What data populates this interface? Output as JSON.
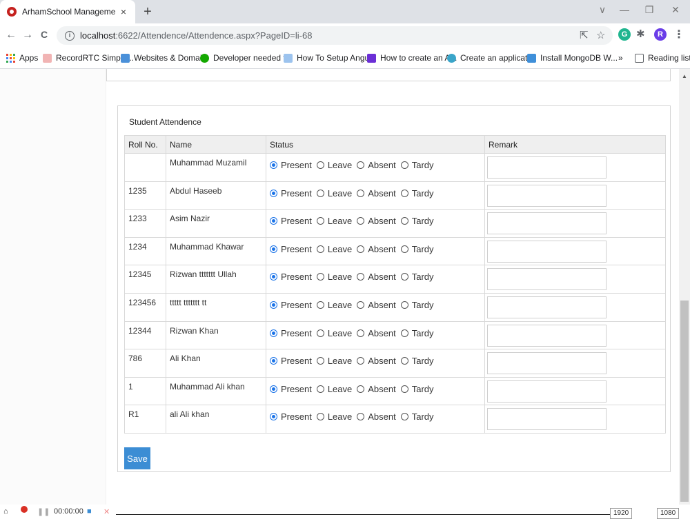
{
  "browser": {
    "tab_title": "ArhamSchool Management",
    "tab_close": "×",
    "new_tab": "+",
    "url_host": "localhost",
    "url_rest": ":6622/Attendence/Attendence.aspx?PageID=li-68",
    "window_controls": [
      "∨",
      "—",
      "❐",
      "✕"
    ],
    "nav": {
      "back": "←",
      "forward": "→",
      "reload": "C"
    },
    "extensions": [
      {
        "label": "G",
        "color": "#1fb58f"
      },
      {
        "label": "R",
        "color": "#6a3de8"
      }
    ],
    "bookmarks": [
      {
        "label": "Apps",
        "icon": "apps-grid-icon",
        "color": "#ea4335"
      },
      {
        "label": "RecordRTC Simple...",
        "icon": "recordrtc-icon",
        "color": "#e98b8b"
      },
      {
        "label": "Websites & Domai...",
        "icon": "websites-icon",
        "color": "#4a90d9"
      },
      {
        "label": "Developer needed f...",
        "icon": "upwork-icon",
        "color": "#14a800"
      },
      {
        "label": "How To Setup Angu...",
        "icon": "angular-icon",
        "color": "#3f87d8"
      },
      {
        "label": "How to create an A...",
        "icon": "tb-icon",
        "color": "#6b2fd6"
      },
      {
        "label": "Create an applicati...",
        "icon": "gear-doc-icon",
        "color": "#3aa5c9"
      },
      {
        "label": "Install MongoDB W...",
        "icon": "mongodb-icon",
        "color": "#3f8fd9"
      }
    ],
    "bookmarks_more": "»",
    "reading_list": "Reading list"
  },
  "attendance": {
    "title": "Student Attendence",
    "headers": {
      "roll": "Roll No.",
      "name": "Name",
      "status": "Status",
      "remark": "Remark"
    },
    "options": [
      "Present",
      "Leave",
      "Absent",
      "Tardy"
    ],
    "rows": [
      {
        "roll": "",
        "name": "Muhammad Muzamil",
        "status": "Present",
        "remark": ""
      },
      {
        "roll": "1235",
        "name": "Abdul Haseeb",
        "status": "Present",
        "remark": ""
      },
      {
        "roll": "1233",
        "name": "Asim Nazir",
        "status": "Present",
        "remark": ""
      },
      {
        "roll": "1234",
        "name": "Muhammad Khawar",
        "status": "Present",
        "remark": ""
      },
      {
        "roll": "12345",
        "name": "Rizwan ttttttt Ullah",
        "status": "Present",
        "remark": ""
      },
      {
        "roll": "123456",
        "name": "ttttt ttttttt tt",
        "status": "Present",
        "remark": ""
      },
      {
        "roll": "12344",
        "name": "Rizwan Khan",
        "status": "Present",
        "remark": ""
      },
      {
        "roll": "786",
        "name": "Ali Khan",
        "status": "Present",
        "remark": ""
      },
      {
        "roll": "1",
        "name": "Muhammad Ali khan",
        "status": "Present",
        "remark": ""
      },
      {
        "roll": "R1",
        "name": "ali Ali khan",
        "status": "Present",
        "remark": ""
      }
    ],
    "save_label": "Save"
  },
  "recorder": {
    "time": "00:00:00",
    "width_value": "1920",
    "height_value": "1080"
  },
  "colors": {
    "accent": "#1a73e8",
    "save_button": "#3c8dd4"
  }
}
